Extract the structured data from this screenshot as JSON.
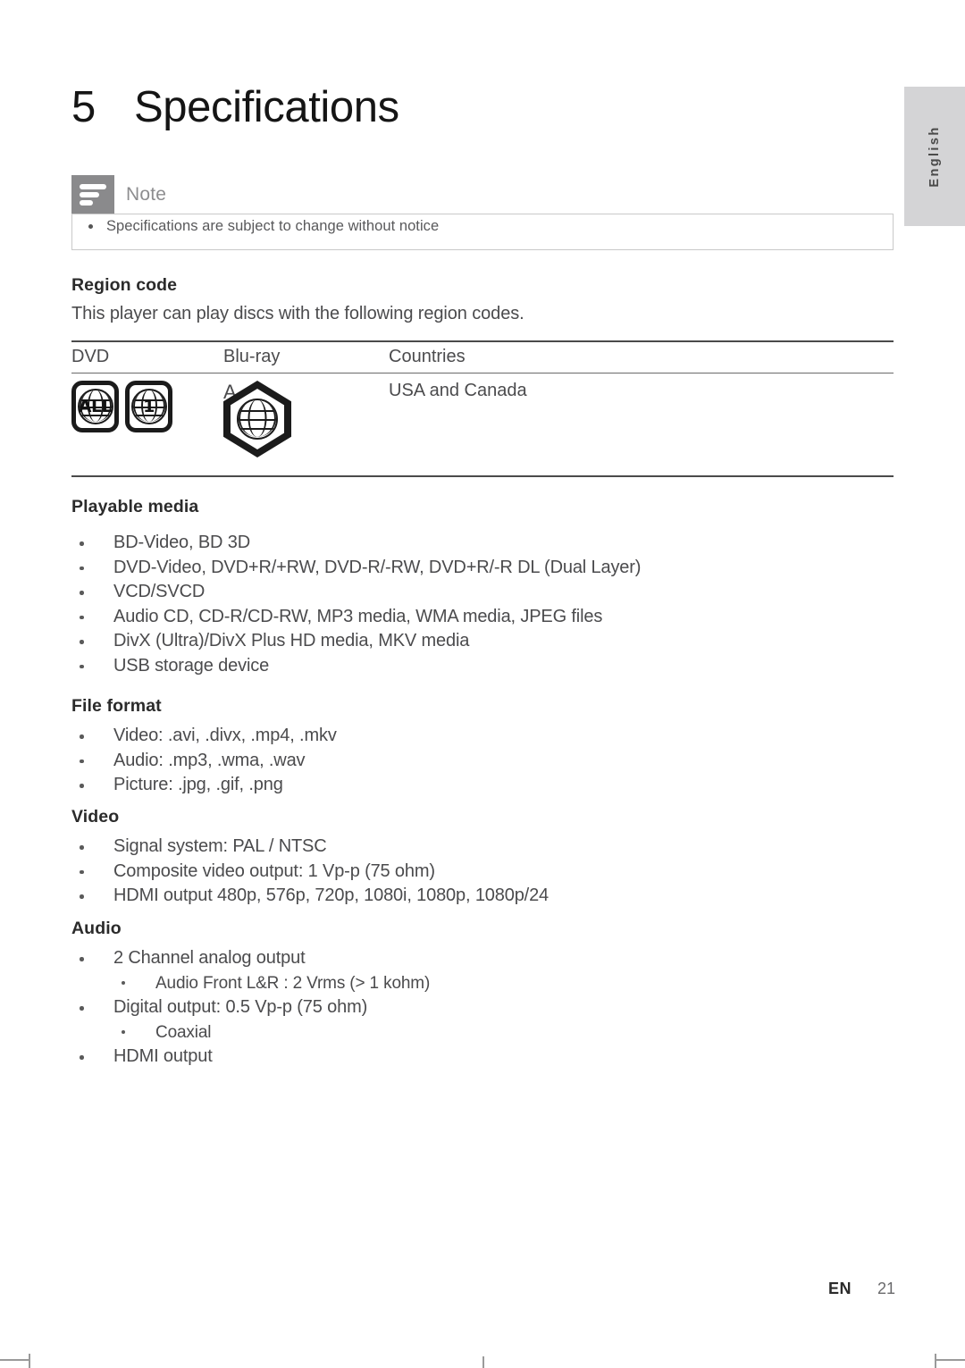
{
  "language_tab": {
    "label": "English"
  },
  "chapter": {
    "number": "5",
    "title": "Specifications"
  },
  "note": {
    "title": "Note",
    "icon": "note-lines-icon",
    "items": [
      "Specifications are subject to change without notice"
    ]
  },
  "region_code": {
    "heading": "Region code",
    "description": "This player can play discs with the following region codes.",
    "table": {
      "headers": [
        "DVD",
        "Blu-ray",
        "Countries"
      ],
      "rows": [
        {
          "dvd_badges": [
            "ALL",
            "1"
          ],
          "bluray_badge": "A",
          "countries": "USA and Canada"
        }
      ]
    }
  },
  "playable_media": {
    "heading": "Playable media",
    "items": [
      "BD-Video, BD 3D",
      "DVD-Video, DVD+R/+RW, DVD-R/-RW, DVD+R/-R DL (Dual Layer)",
      "VCD/SVCD",
      "Audio CD, CD-R/CD-RW, MP3 media, WMA media, JPEG files",
      "DivX (Ultra)/DivX Plus HD media, MKV media",
      "USB storage device"
    ]
  },
  "file_format": {
    "heading": "File format",
    "items": [
      "Video: .avi, .divx, .mp4, .mkv",
      "Audio: .mp3, .wma, .wav",
      "Picture: .jpg, .gif, .png"
    ]
  },
  "video": {
    "heading": "Video",
    "items": [
      "Signal system: PAL / NTSC",
      "Composite video output: 1 Vp-p (75 ohm)",
      "HDMI output 480p, 576p, 720p, 1080i, 1080p, 1080p/24"
    ]
  },
  "audio": {
    "heading": "Audio",
    "items": [
      {
        "text": "2 Channel analog output",
        "level": 1
      },
      {
        "text": "Audio Front L&R : 2 Vrms (> 1 kohm)",
        "level": 2
      },
      {
        "text": "Digital output: 0.5 Vp-p (75 ohm)",
        "level": 1
      },
      {
        "text": "Coaxial",
        "level": 2
      },
      {
        "text": "HDMI output",
        "level": 1
      }
    ]
  },
  "footer": {
    "language_code": "EN",
    "page_number": "21"
  },
  "colors": {
    "page_background": "#ffffff",
    "body_text": "#4b4b4d",
    "heading_text": "#2b2b2b",
    "note_icon_background": "#8a8a8c",
    "note_title_text": "#8d8d8f",
    "tab_background": "#d4d4d6",
    "rule": "#4a4a4a"
  }
}
